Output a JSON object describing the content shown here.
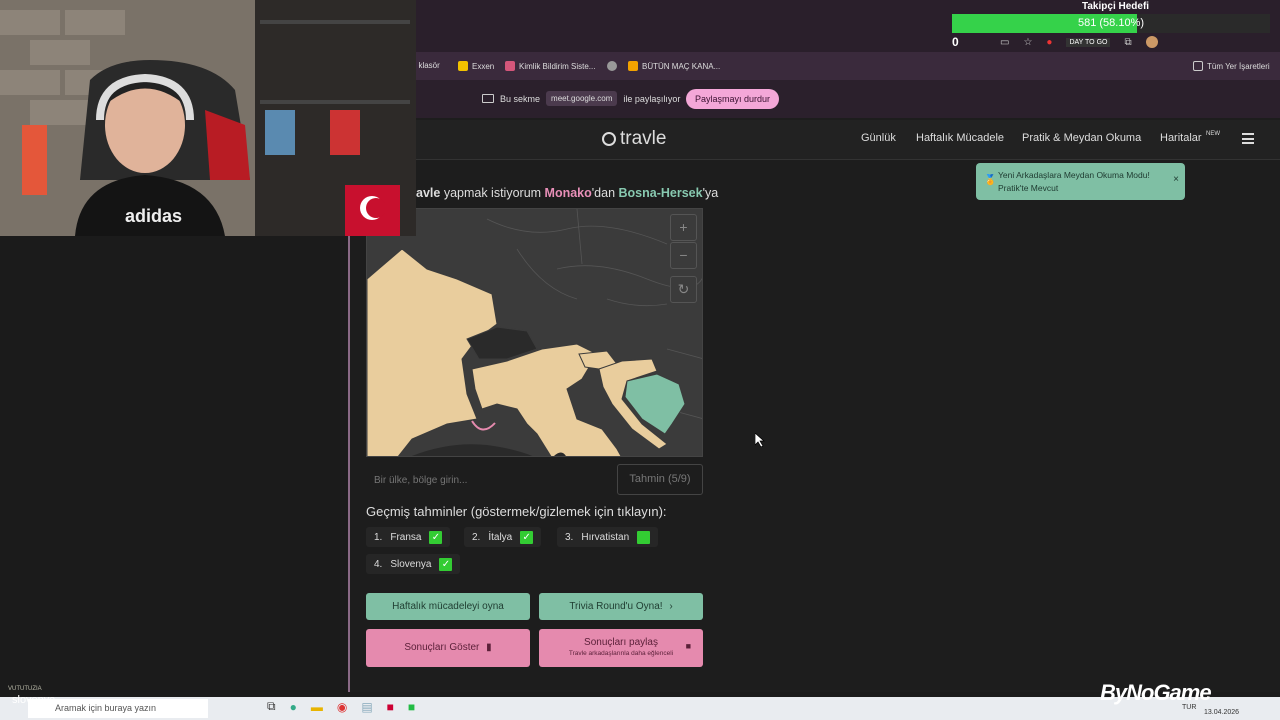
{
  "goal": {
    "title": "Takipçi Hedefi",
    "progress_text": "581 (58.10%)",
    "progress_fraction": 0.581,
    "counter": "0"
  },
  "browser": {
    "bookmarks": [
      "ni klasör",
      "Exxen",
      "Kimlik Bildirim Siste...",
      "BÜTÜN MAÇ KANA...",
      "Tüm Yer İşaretleri"
    ],
    "share_prefix": "Bu sekme",
    "share_url": "meet.google.com",
    "share_suffix": "ile paylaşılıyor",
    "stop_share": "Paylaşmayı durdur"
  },
  "site": {
    "logo": "travle",
    "nav": [
      "Günlük",
      "Haftalık Mücadele",
      "Pratik & Meydan Okuma",
      "Haritalar"
    ],
    "new_badge": "NEW",
    "toast_line1": "Yeni Arkadaşlara Meydan Okuma Modu!",
    "toast_line2": "Pratik'te Mevcut",
    "toast_close": "×",
    "prompt_start": "avle",
    "prompt_mid": " yapmak istiyorum ",
    "from": "Monako",
    "from_suffix": "'dan ",
    "to": "Bosna-Hersek",
    "to_suffix": "'ya",
    "map_zoom_in": "+",
    "map_zoom_out": "−",
    "map_reset": "↻",
    "input_placeholder": "Bir ülke, bölge girin...",
    "guess_button": "Tahmin (5/9)",
    "history_title": "Geçmiş tahminler (göstermek/gizlemek için tıklayın):",
    "guesses": [
      {
        "num": "1.",
        "name": "Fransa"
      },
      {
        "num": "2.",
        "name": "İtalya"
      },
      {
        "num": "3.",
        "name": "Hırvatistan"
      },
      {
        "num": "4.",
        "name": "Slovenya"
      }
    ],
    "btn_weekly": "Haftalık mücadeleyi oyna",
    "btn_trivia": "Trivia Round'u Oyna!",
    "btn_results": "Sonuçları Göster",
    "btn_share": "Sonuçları paylaş",
    "btn_share_sub": "Travle arkadaşlarınla daha eğlenceli"
  },
  "taskbar": {
    "search_placeholder": "Aramak için buraya yazın",
    "lang": "TUR",
    "date": "13.04.2026"
  },
  "overlay": {
    "chat_user": "VUTUTUZIA",
    "chat_text": "slovenya",
    "brand": "ByNoGame",
    "speaker_label": "DAY TO GO"
  },
  "colors": {
    "accent_green": "#7fbfa4",
    "accent_pink": "#e58aae",
    "goal_fill": "#35d24a"
  }
}
